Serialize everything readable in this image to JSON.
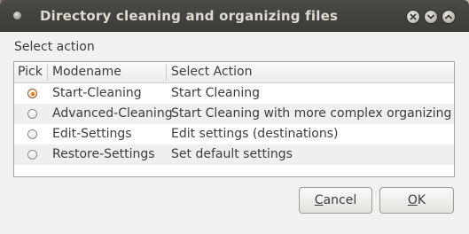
{
  "window": {
    "title": "Directory cleaning and organizing files"
  },
  "dialog": {
    "section_label": "Select action",
    "columns": [
      "Pick",
      "Modename",
      "Select Action"
    ],
    "rows": [
      {
        "picked": true,
        "modename": "Start-Cleaning",
        "action": "Start Cleaning"
      },
      {
        "picked": false,
        "modename": "Advanced-Cleaning",
        "action": "Start Cleaning with more complex organizing"
      },
      {
        "picked": false,
        "modename": "Edit-Settings",
        "action": "Edit settings (destinations)"
      },
      {
        "picked": false,
        "modename": "Restore-Settings",
        "action": "Set default settings"
      }
    ]
  },
  "buttons": {
    "cancel_mnemonic": "C",
    "cancel_rest": "ancel",
    "ok_mnemonic": "O",
    "ok_rest": "K"
  },
  "colors": {
    "titlebar": "#3c3b37",
    "title_text": "#dfdbd2",
    "dialog_bg": "#f2f1f0",
    "radio_accent": "#e0752b"
  },
  "icons": {
    "app": "window-menu-dot-icon",
    "close": "close-icon",
    "minimize": "minimize-icon",
    "maximize": "maximize-icon"
  }
}
